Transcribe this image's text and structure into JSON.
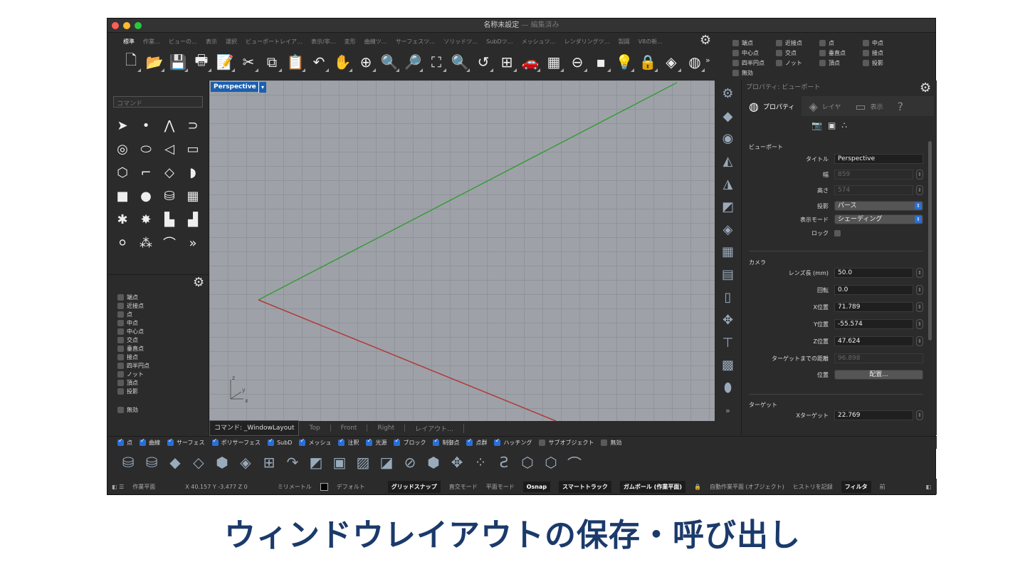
{
  "window": {
    "title": "名称未設定",
    "title_suffix": "— 編集済み"
  },
  "tabs": [
    "標準",
    "作業…",
    "ビューの…",
    "表示",
    "選択",
    "ビューポートレイア…",
    "表示/非…",
    "変形",
    "曲線ツ…",
    "サーフェスツ…",
    "ソリッドツ…",
    "SubDツ…",
    "メッシュツ…",
    "レンダリングツ…",
    "製図",
    "V8の新…"
  ],
  "toolbar_icons": [
    "new-file",
    "open-folder",
    "save",
    "print",
    "import",
    "cut",
    "copy",
    "paste",
    "undo",
    "pan-hand",
    "rotate-view",
    "zoom",
    "zoom-window",
    "zoom-extents",
    "zoom-selected",
    "undo-view",
    "four-viewports",
    "car-render",
    "grid-render",
    "toggle",
    "osnap-points",
    "light-bulb",
    "lock",
    "layer",
    "color-wheel"
  ],
  "toolbar_glyphs": [
    "🗋",
    "📂",
    "💾",
    "🖶",
    "📝",
    "✂",
    "⧉",
    "📋",
    "↶",
    "✋",
    "⊕",
    "🔍",
    "🔎",
    "⛶",
    "🔍",
    "↺",
    "⊞",
    "🚗",
    "▦",
    "⊖",
    "▪",
    "💡",
    "🔒",
    "◈",
    "◍"
  ],
  "osnap_top": [
    {
      "label": "端点"
    },
    {
      "label": "近接点"
    },
    {
      "label": "点"
    },
    {
      "label": "中点"
    },
    {
      "label": "中心点"
    },
    {
      "label": "交点"
    },
    {
      "label": "垂直点"
    },
    {
      "label": "接点"
    },
    {
      "label": "四半円点"
    },
    {
      "label": "ノット"
    },
    {
      "label": "頂点"
    },
    {
      "label": "投影"
    },
    {
      "label": "無効"
    }
  ],
  "command": {
    "placeholder": "コマンド"
  },
  "left_icons": [
    "select-arrow",
    "point",
    "polyline",
    "curve",
    "circle",
    "ellipse",
    "arc",
    "rectangle",
    "polygon",
    "fillet",
    "surface-point",
    "surface-sweep",
    "box",
    "sphere",
    "cylinder",
    "mesh-surface",
    "puzzle",
    "explode",
    "trim",
    "split",
    "boolean-union",
    "boolean-split",
    "curve-edit"
  ],
  "left_glyphs": [
    "➤",
    "•",
    "⋀",
    "⊃",
    "◎",
    "⬭",
    "◁",
    "▭",
    "⬡",
    "⌐",
    "◇",
    "◗",
    "■",
    "●",
    "⛁",
    "▦",
    "✱",
    "✸",
    "▙",
    "▟",
    "⚪",
    "⁂",
    "⌒"
  ],
  "left_more": "»",
  "osnap_left": [
    "端点",
    "近接点",
    "点",
    "中点",
    "中心点",
    "交点",
    "垂直点",
    "接点",
    "四半円点",
    "ノット",
    "頂点",
    "投影"
  ],
  "osnap_left_disable": "無効",
  "viewport": {
    "label": "Perspective",
    "axis_x": "x",
    "axis_y": "y",
    "axis_z": "z"
  },
  "viewport_tabs": [
    {
      "label": "コマンド: _WindowLayout",
      "active": true
    },
    {
      "label": "Top"
    },
    {
      "label": "Front"
    },
    {
      "label": "Right"
    },
    {
      "label": "レイアウト…"
    }
  ],
  "vertical_icons": [
    "gear",
    "cage-edit",
    "disk",
    "surface-a",
    "surface-b",
    "surface-c",
    "surface-d",
    "plane-a",
    "plane-b",
    "plane-c",
    "move",
    "extrude",
    "render-colors",
    "cylinder-view"
  ],
  "vertical_glyphs": [
    "⚙",
    "◆",
    "◉",
    "◭",
    "◮",
    "◩",
    "◈",
    "▦",
    "▤",
    "▯",
    "✥",
    "⊤",
    "▩",
    "⬮"
  ],
  "vertical_more": "»",
  "properties": {
    "header": "プロパティ: ビューポート",
    "tabs": [
      {
        "label": "プロパティ",
        "icon": "color-wheel",
        "glyph": "◍"
      },
      {
        "label": "レイヤ",
        "icon": "layers",
        "glyph": "◈"
      },
      {
        "label": "表示",
        "icon": "monitor",
        "glyph": "▭"
      },
      {
        "label": "",
        "icon": "help",
        "glyph": "?"
      }
    ],
    "sub_icons": [
      "camera",
      "frame",
      "blob"
    ],
    "sub_glyphs": [
      "📷",
      "▣",
      "∴"
    ],
    "viewport_section": "ビューポート",
    "title_label": "タイトル",
    "title_value": "Perspective",
    "width_label": "幅",
    "width_value": "859",
    "height_label": "高さ",
    "height_value": "574",
    "projection_label": "投影",
    "projection_value": "パース",
    "display_label": "表示モード",
    "display_value": "シェーディング",
    "lock_label": "ロック",
    "camera_section": "カメラ",
    "lens_label": "レンズ長 (mm)",
    "lens_value": "50.0",
    "rotation_label": "回転",
    "rotation_value": "0.0",
    "x_label": "X位置",
    "x_value": "71.789",
    "y_label": "Y位置",
    "y_value": "-55.574",
    "z_label": "Z位置",
    "z_value": "47.624",
    "dist_label": "ターゲットまでの距離",
    "dist_value": "96.898",
    "pos_label": "位置",
    "place_button": "配置...",
    "target_section": "ターゲット",
    "xt_label": "Xターゲット",
    "xt_value": "22.769"
  },
  "filters": [
    {
      "label": "点",
      "on": true
    },
    {
      "label": "曲線",
      "on": true
    },
    {
      "label": "サーフェス",
      "on": true
    },
    {
      "label": "ポリサーフェス",
      "on": true
    },
    {
      "label": "SubD",
      "on": true
    },
    {
      "label": "メッシュ",
      "on": true
    },
    {
      "label": "注釈",
      "on": true
    },
    {
      "label": "光源",
      "on": true
    },
    {
      "label": "ブロック",
      "on": true
    },
    {
      "label": "制御点",
      "on": true
    },
    {
      "label": "点群",
      "on": true
    },
    {
      "label": "ハッチング",
      "on": true
    },
    {
      "label": "サブオブジェクト",
      "on": false
    },
    {
      "label": "無効",
      "on": false
    }
  ],
  "bottom_icons": [
    "cylinder-a",
    "cylinder-b",
    "surface-1",
    "surface-2",
    "box",
    "surface-3",
    "surface-4",
    "rotate",
    "surface-5",
    "surface-6",
    "surface-7",
    "surface-8",
    "sphere-cut",
    "cube",
    "surface-9",
    "points",
    "surface-10",
    "cube-wire",
    "cube-pencil",
    "curve-fillet"
  ],
  "bottom_glyphs": [
    "⛁",
    "⛁",
    "◆",
    "◇",
    "⬢",
    "◈",
    "⊞",
    "↷",
    "◩",
    "▣",
    "▨",
    "◪",
    "⊘",
    "⬢",
    "✥",
    "⁘",
    "Ƨ",
    "⬡",
    "⬡",
    "⌒"
  ],
  "status": {
    "cplane": "作業平面",
    "coords": "X 40.157 Y -3.477 Z 0",
    "units": "ミリメートル",
    "layer": "デフォルト",
    "grid_snap": "グリッドスナップ",
    "ortho": "直交モード",
    "planar": "平面モード",
    "osnap": "Osnap",
    "smart_track": "スマートトラック",
    "gumball": "ガムボール (作業平面)",
    "auto_cplane": "自動作業平面 (オブジェクト)",
    "history": "ヒストリを記録",
    "filter": "フィルタ",
    "prev": "前"
  },
  "caption": "ウィンドウレイアウトの保存・呼び出し",
  "colors": {
    "caption": "#1b3a6b",
    "viewport_bg": "#9ea2a8",
    "accent": "#1c5fae",
    "x_axis": "#b03a3a",
    "y_axis": "#3a9a3a"
  }
}
